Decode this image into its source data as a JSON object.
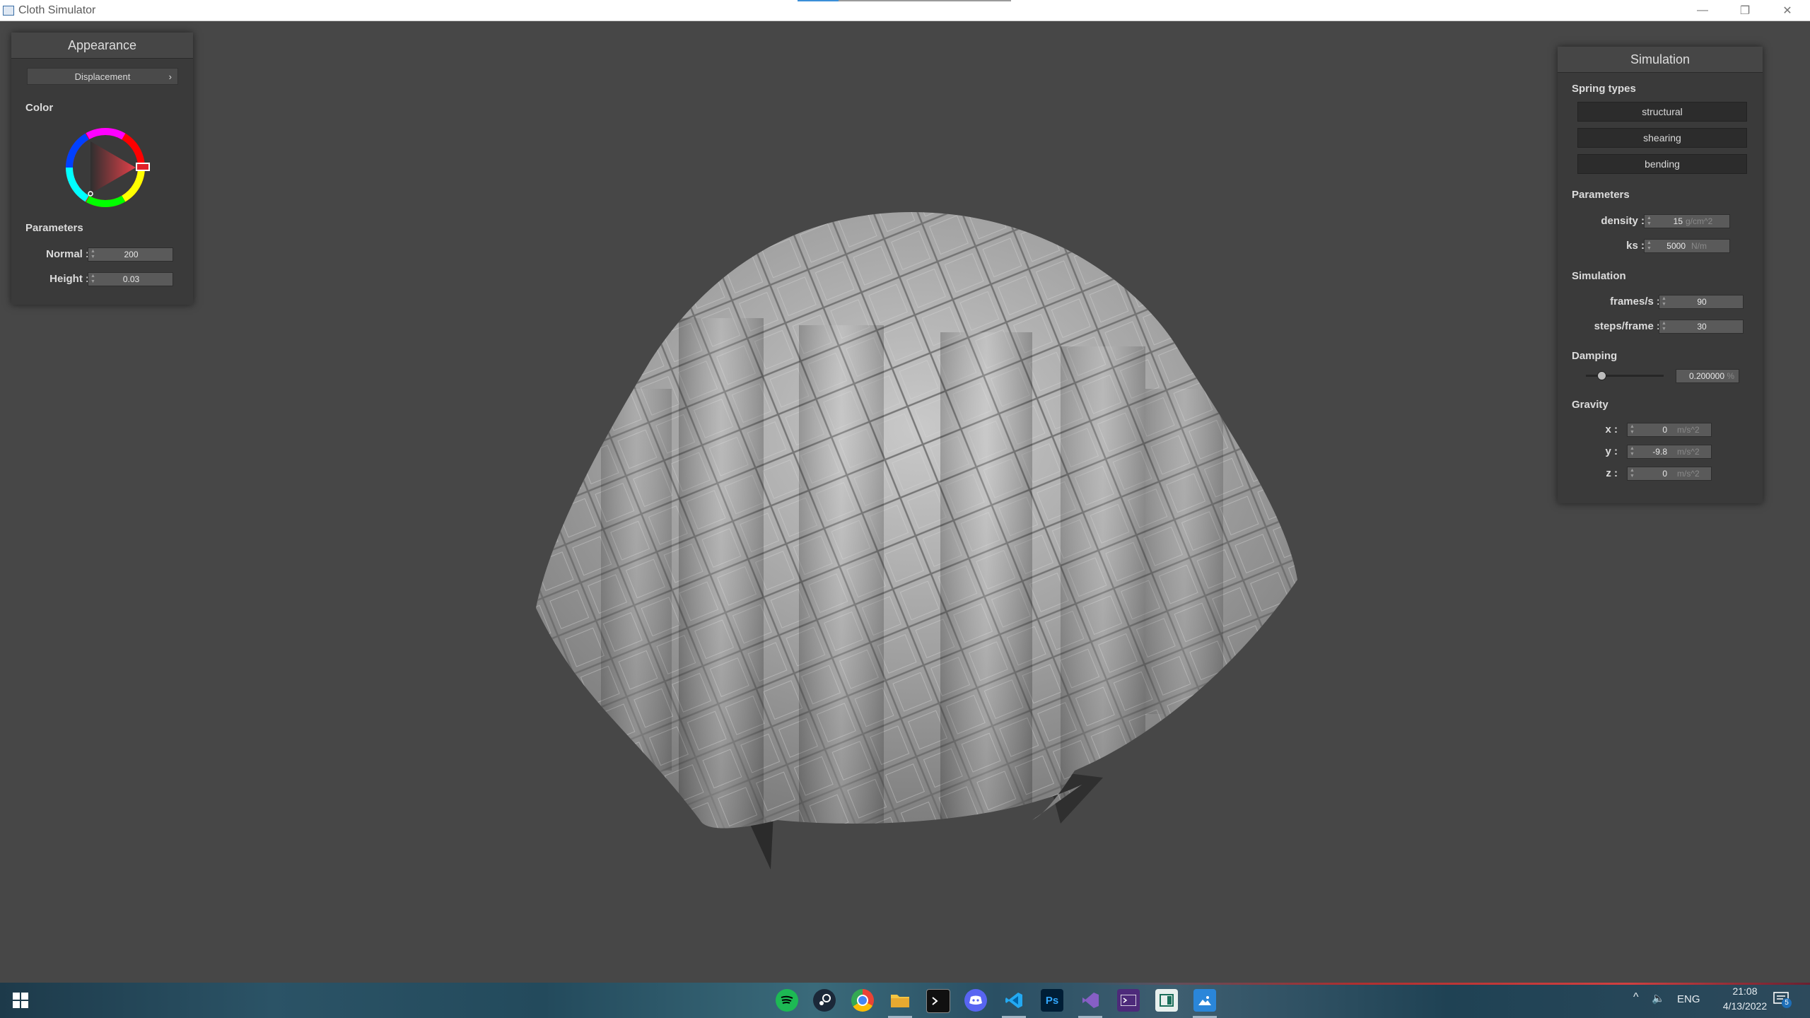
{
  "window": {
    "title": "Cloth Simulator",
    "controls": {
      "minimize": "—",
      "maximize": "❐",
      "close": "✕"
    }
  },
  "appearance": {
    "title": "Appearance",
    "mode_button": "Displacement",
    "mode_arrow": "›",
    "color_label": "Color",
    "params_label": "Parameters",
    "normal_label": "Normal :",
    "normal_value": "200",
    "height_label": "Height :",
    "height_value": "0.03",
    "wheel_color": "#e0202a"
  },
  "simulation": {
    "title": "Simulation",
    "spring_types_label": "Spring types",
    "springs": [
      "structural",
      "shearing",
      "bending"
    ],
    "params_label": "Parameters",
    "density_label": "density :",
    "density_value": "15",
    "density_unit": "g/cm^2",
    "ks_label": "ks :",
    "ks_value": "5000",
    "ks_unit": "N/m",
    "sim_label": "Simulation",
    "fps_label": "frames/s :",
    "fps_value": "90",
    "steps_label": "steps/frame :",
    "steps_value": "30",
    "damping_label": "Damping",
    "damping_value": "0.200000",
    "damping_unit": "%",
    "damping_fraction": 0.2,
    "gravity_label": "Gravity",
    "gx_label": "x :",
    "gx_value": "0",
    "gy_label": "y :",
    "gy_value": "-9.8",
    "gz_label": "z :",
    "gz_value": "0",
    "gravity_unit": "m/s^2"
  },
  "taskbar": {
    "apps": [
      "spotify-icon",
      "steam-icon",
      "chrome-icon",
      "file-explorer-icon",
      "terminal-icon",
      "discord-icon",
      "vscode-icon",
      "photoshop-icon",
      "visual-studio-icon",
      "console-icon",
      "window-app-icon",
      "photos-icon"
    ],
    "photoshop_text": "Ps",
    "language": "ENG",
    "time": "21:08",
    "date": "4/13/2022",
    "notifications": "5"
  }
}
